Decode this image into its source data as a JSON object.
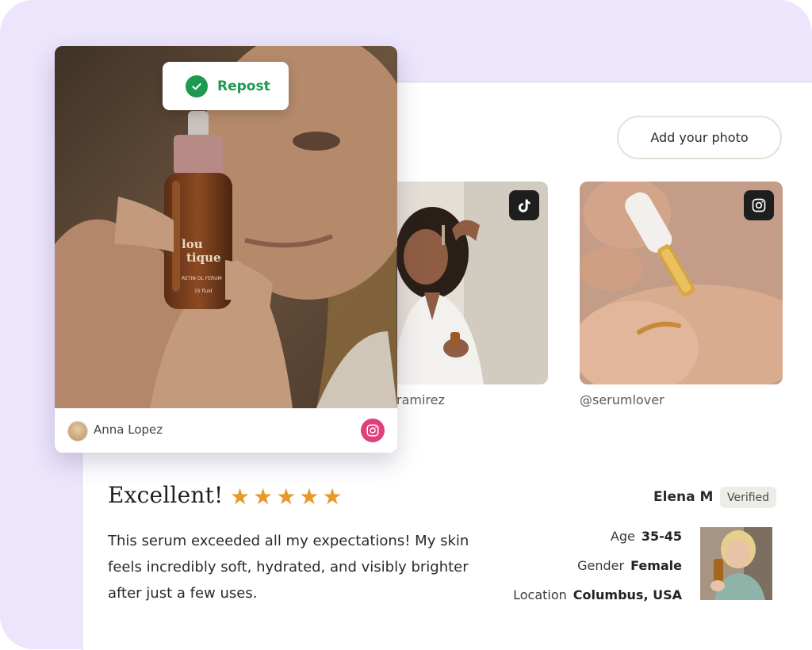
{
  "actions": {
    "add_photo_label": "Add your photo",
    "repost_label": "Repost"
  },
  "ugc": [
    {
      "handle": "ramirez",
      "platform_icon": "tiktok-icon"
    },
    {
      "handle": "@serumlover",
      "platform_icon": "instagram-icon"
    }
  ],
  "featured": {
    "author": "Anna Lopez",
    "platform_icon": "instagram-icon",
    "product_brand_top": "lou",
    "product_brand_bottom": "tique",
    "product_name": "RETIN OL FERUM",
    "product_volume": "15 fluid"
  },
  "review": {
    "title": "Excellent!",
    "rating": 5,
    "stars": [
      "★",
      "★",
      "★",
      "★",
      "★"
    ],
    "body": "This serum exceeded all my expectations! My skin feels incredibly soft, hydrated, and visibly brighter after just a few uses.",
    "reviewer_name": "Elena M",
    "verified_label": "Verified",
    "attributes": [
      {
        "label": "Age",
        "value": "35-45"
      },
      {
        "label": "Gender",
        "value": "Female"
      },
      {
        "label": "Location",
        "value": "Columbus, USA"
      }
    ]
  },
  "colors": {
    "background": "#ece5fc",
    "accent_green": "#1d9a4f",
    "star": "#e79a2a",
    "instagram": "#e0407a"
  }
}
